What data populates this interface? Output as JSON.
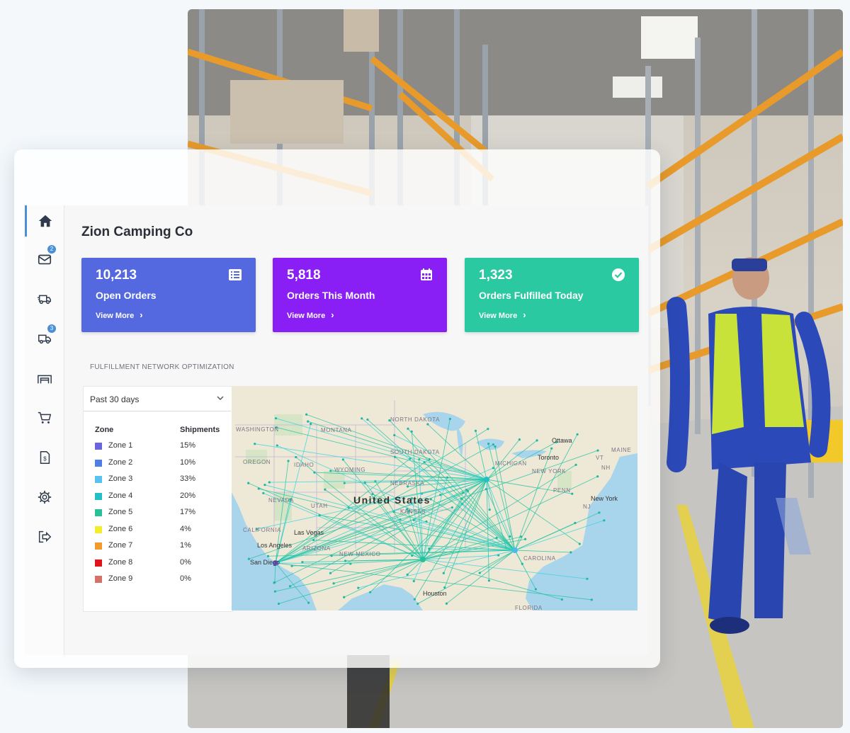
{
  "company": "Zion Camping Co",
  "nav": [
    {
      "name": "home-icon",
      "badge": ""
    },
    {
      "name": "mail-icon",
      "badge": "2"
    },
    {
      "name": "truck-fast-icon",
      "badge": ""
    },
    {
      "name": "truck-icon",
      "badge": "3"
    },
    {
      "name": "warehouse-icon",
      "badge": ""
    },
    {
      "name": "cart-icon",
      "badge": ""
    },
    {
      "name": "invoice-icon",
      "badge": ""
    },
    {
      "name": "gear-icon",
      "badge": ""
    },
    {
      "name": "logout-icon",
      "badge": ""
    }
  ],
  "stats": [
    {
      "value": "10,213",
      "label": "Open Orders",
      "more": "View More",
      "color": "#5469e0",
      "icon": "list-icon"
    },
    {
      "value": "5,818",
      "label": "Orders This Month",
      "more": "View More",
      "color": "#8a1ff5",
      "icon": "calendar-icon"
    },
    {
      "value": "1,323",
      "label": "Orders Fulfilled Today",
      "more": "View More",
      "color": "#2bc9a1",
      "icon": "check-circle-icon"
    }
  ],
  "section_title": "FULFILLMENT NETWORK OPTIMIZATION",
  "filter": {
    "selected": "Past 30 days"
  },
  "legend": {
    "col_zone": "Zone",
    "col_shipments": "Shipments",
    "rows": [
      {
        "zone": "Zone 1",
        "pct": "15%",
        "color": "#6b63e0"
      },
      {
        "zone": "Zone 2",
        "pct": "10%",
        "color": "#4f7de8"
      },
      {
        "zone": "Zone 3",
        "pct": "33%",
        "color": "#58c3f0"
      },
      {
        "zone": "Zone 4",
        "pct": "20%",
        "color": "#22bfc6"
      },
      {
        "zone": "Zone 5",
        "pct": "17%",
        "color": "#26c199"
      },
      {
        "zone": "Zone 6",
        "pct": "4%",
        "color": "#f4ee2a"
      },
      {
        "zone": "Zone 7",
        "pct": "1%",
        "color": "#f39a2b"
      },
      {
        "zone": "Zone 8",
        "pct": "0%",
        "color": "#e0141b"
      },
      {
        "zone": "Zone 9",
        "pct": "0%",
        "color": "#d6716a"
      }
    ]
  },
  "map": {
    "labels": [
      {
        "t": "WASHINGTON",
        "cls": "state"
      },
      {
        "t": "MONTANA",
        "cls": "state"
      },
      {
        "t": "NORTH DAKOTA",
        "cls": "state"
      },
      {
        "t": "OREGON",
        "cls": "state"
      },
      {
        "t": "IDAHO",
        "cls": "state"
      },
      {
        "t": "WYOMING",
        "cls": "state"
      },
      {
        "t": "SOUTH DAKOTA",
        "cls": "state"
      },
      {
        "t": "NEVADA",
        "cls": "state"
      },
      {
        "t": "UTAH",
        "cls": "state"
      },
      {
        "t": "CALIFORNIA",
        "cls": "state"
      },
      {
        "t": "ARIZONA",
        "cls": "state"
      },
      {
        "t": "NEW MEXICO",
        "cls": "state"
      },
      {
        "t": "NEBRASKA",
        "cls": "state"
      },
      {
        "t": "KANSAS",
        "cls": "state"
      },
      {
        "t": "MICHIGAN",
        "cls": "state"
      },
      {
        "t": "NEW YORK",
        "cls": "state"
      },
      {
        "t": "MAINE",
        "cls": "state"
      },
      {
        "t": "PENN",
        "cls": "state"
      },
      {
        "t": "United States",
        "cls": "country"
      },
      {
        "t": "Ottawa",
        "cls": "city"
      },
      {
        "t": "Toronto",
        "cls": "city"
      },
      {
        "t": "New York",
        "cls": "city"
      },
      {
        "t": "Las Vegas",
        "cls": "city"
      },
      {
        "t": "Los Angeles",
        "cls": "city"
      },
      {
        "t": "San Diego",
        "cls": "city"
      },
      {
        "t": "Houston",
        "cls": "city"
      },
      {
        "t": "NH",
        "cls": "state"
      },
      {
        "t": "VT",
        "cls": "state"
      },
      {
        "t": "NJ",
        "cls": "state"
      },
      {
        "t": "FLORIDA",
        "cls": "state"
      },
      {
        "t": "CAROLINA",
        "cls": "state"
      }
    ],
    "hubs": [
      {
        "name": "Los Angeles hub",
        "color": "#6b63e0"
      },
      {
        "name": "Texas hub",
        "color": "#26c199"
      },
      {
        "name": "Midwest hub",
        "color": "#22bfc6"
      },
      {
        "name": "Southeast hub",
        "color": "#4fb8e8"
      }
    ]
  }
}
